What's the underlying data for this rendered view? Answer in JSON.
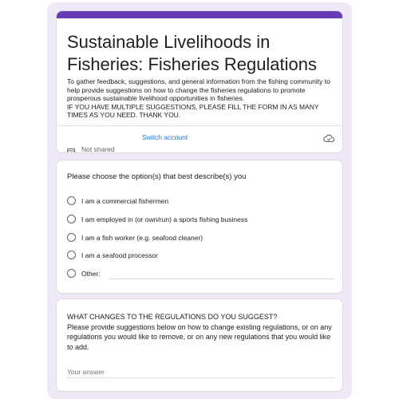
{
  "header": {
    "title": "Sustainable Livelihoods in Fisheries: Fisheries Regulations",
    "description_lines": [
      "To gather feedback, suggestions, and general information from the fishing community to help provide suggestions on how to change the fisheries regulations to promote prosperous sustainable livelihood opportunities in fisheries.",
      "IF YOU HAVE MULTIPLE SUGGESTIONS, PLEASE FILL THE FORM IN AS MANY TIMES AS YOU NEED. THANK YOU."
    ],
    "switch_account_label": "Switch account",
    "not_shared_label": "Not shared",
    "cloud_icon": "cloud-saved-icon",
    "not_shared_icon": "not-shared-icon",
    "accent_color": "#673ab7"
  },
  "question1": {
    "title": "Please choose the option(s) that best describe(s) you",
    "options": [
      "I am a commercial fishermen",
      "I am employed in (or own/run) a sports fishing business",
      "I am a fish worker (e.g. seafood cleaner)",
      "I am a seafood processor",
      "Other:"
    ]
  },
  "question2": {
    "title_line": "WHAT CHANGES TO THE REGULATIONS DO YOU SUGGEST?",
    "body": "Please provide suggestions below on how to change existing regulations, or on any regulations you would like to remove, or on any new regulations that you would like to add.",
    "answer_placeholder": "Your answer"
  },
  "colors": {
    "background": "#efe9f7",
    "link": "#1a73e8"
  }
}
